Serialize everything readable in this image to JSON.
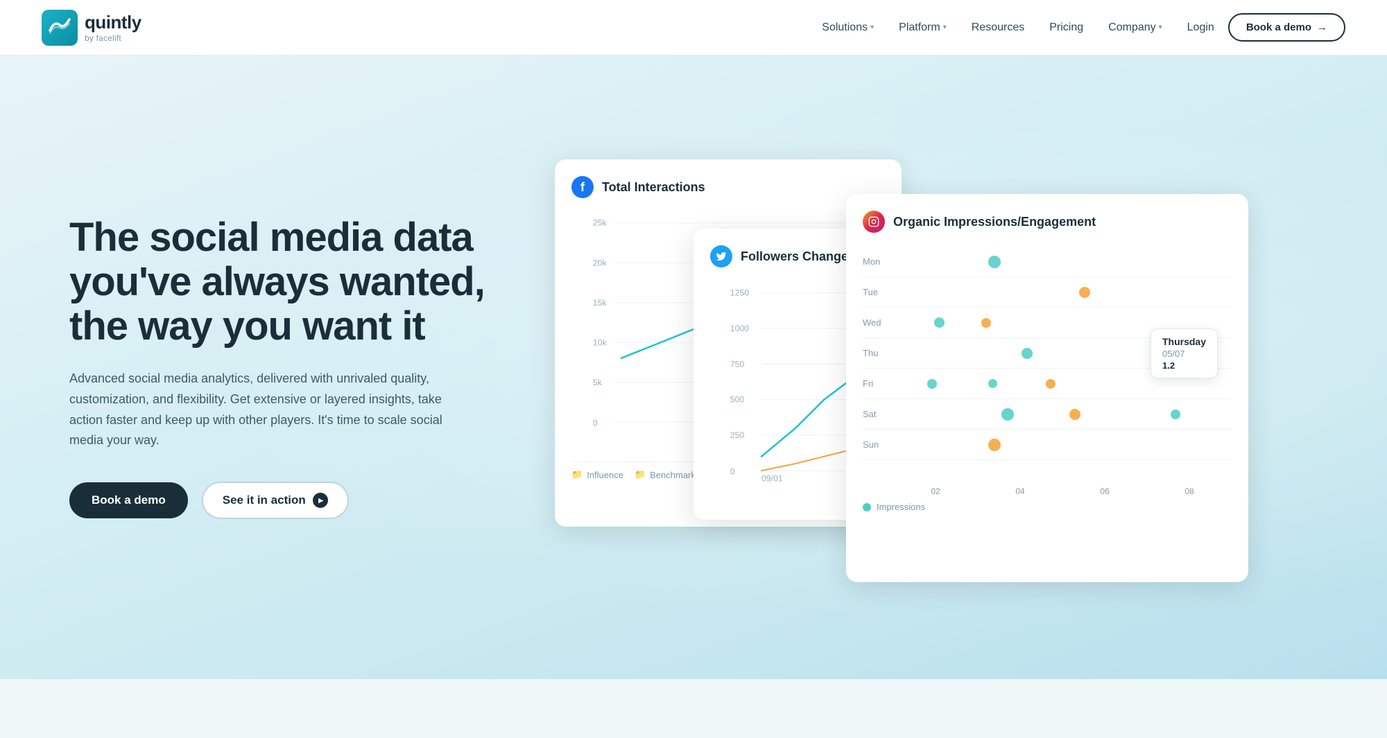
{
  "nav": {
    "logo_name": "quintly",
    "logo_sub": "by facelift",
    "links": [
      {
        "label": "Solutions",
        "has_dropdown": true
      },
      {
        "label": "Platform",
        "has_dropdown": true
      },
      {
        "label": "Resources",
        "has_dropdown": false
      },
      {
        "label": "Pricing",
        "has_dropdown": false
      },
      {
        "label": "Company",
        "has_dropdown": true
      }
    ],
    "login_label": "Login",
    "cta_label": "Book a demo"
  },
  "hero": {
    "title": "The social media data you've always wanted, the way you want it",
    "description": "Advanced social media analytics, delivered with unrivaled quality, customization, and flexibility. Get extensive or layered insights, take action faster and keep up with other players. It's time to scale social media your way.",
    "btn_primary": "Book a demo",
    "btn_secondary": "See it in action"
  },
  "panel_interactions": {
    "title": "Total Interactions",
    "platform": "facebook",
    "y_labels": [
      "25k",
      "20k",
      "15k",
      "10k",
      "5k",
      "0"
    ],
    "footer_items": [
      "Influence",
      "Benchmark"
    ]
  },
  "panel_followers": {
    "title": "Followers Change Rate",
    "platform": "twitter",
    "y_labels": [
      "1250",
      "1000",
      "750",
      "500",
      "250",
      "0"
    ],
    "x_labels": [
      "09/01"
    ]
  },
  "panel_organic": {
    "title": "Organic Impressions/Engagement",
    "platform": "instagram",
    "days": [
      "Mon",
      "Tue",
      "Wed",
      "Thu",
      "Fri",
      "Sat",
      "Sun"
    ],
    "x_labels": [
      "02",
      "04",
      "06",
      "08"
    ],
    "tooltip": {
      "title": "Thursday",
      "date": "05/07",
      "value": "1.2"
    },
    "legend_label": "Impressions"
  },
  "colors": {
    "brand_dark": "#1a2e3a",
    "brand_teal": "#0d8ca0",
    "teal_dot": "#4ecdc4",
    "orange_dot": "#f7a540",
    "blue_dot": "#4a9eff",
    "fb_blue": "#1877f2",
    "tw_blue": "#1da1f2"
  }
}
